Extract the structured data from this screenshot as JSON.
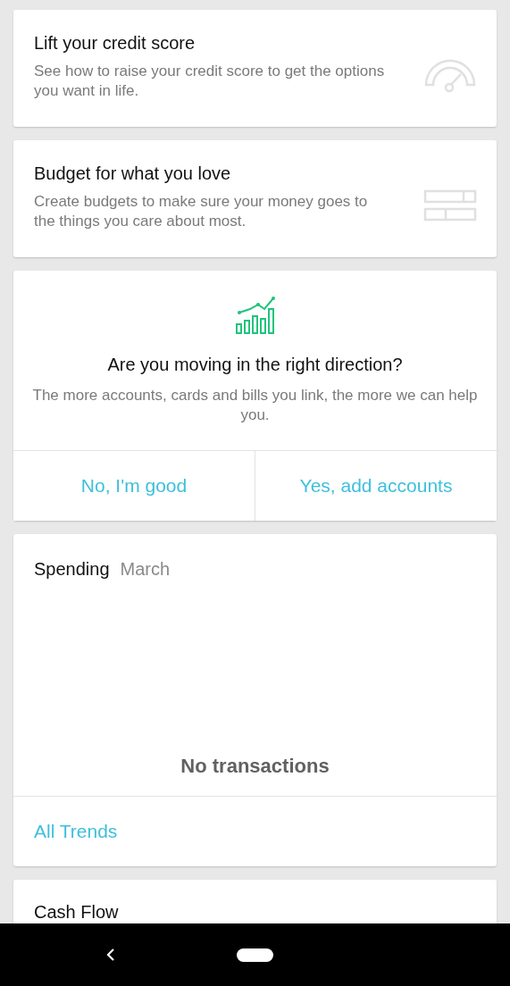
{
  "promos": [
    {
      "title": "Lift your credit score",
      "text": "See how to raise your credit score to get the options you want in life."
    },
    {
      "title": "Budget for what you love",
      "text": "Create budgets to make sure your money goes to the things you care about most."
    }
  ],
  "link_prompt": {
    "title": "Are you moving in the right direction?",
    "text": "The more accounts, cards and bills you link, the more we can help you.",
    "buttons": [
      "No, I'm good",
      "Yes, add accounts"
    ]
  },
  "spending": {
    "title": "Spending",
    "period": "March",
    "empty": "No transactions",
    "link": "All Trends"
  },
  "cash_flow": {
    "title": "Cash Flow"
  }
}
